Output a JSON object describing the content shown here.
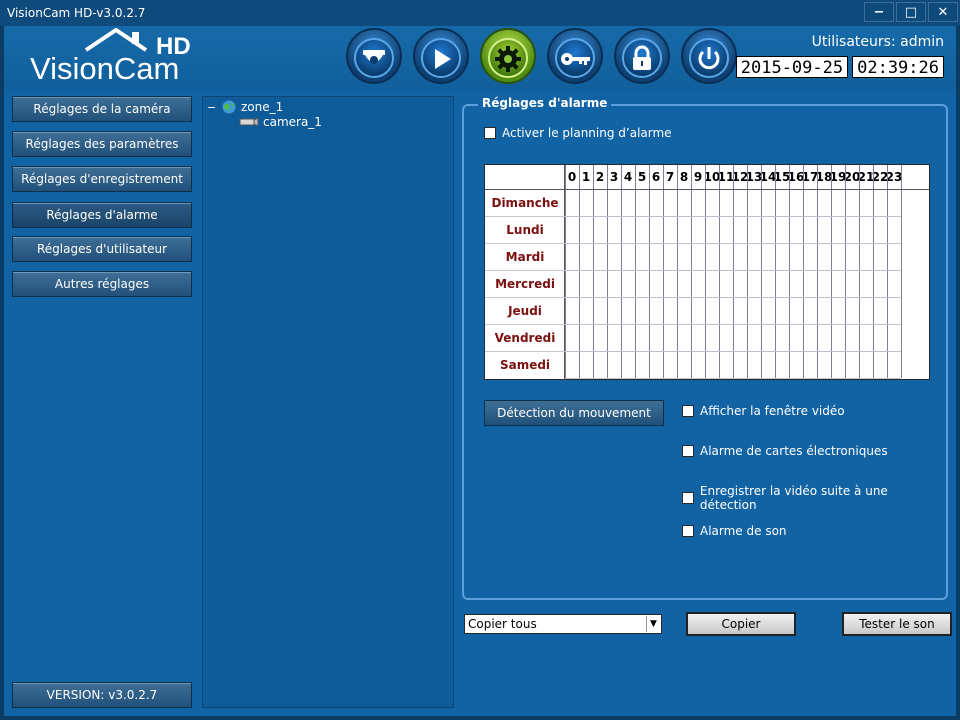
{
  "window": {
    "title": "VisionCam HD-v3.0.2.7",
    "minimize_label": "−",
    "maximize_label": "□",
    "close_label": "✕"
  },
  "header": {
    "logo_brand": "VisionCam",
    "logo_badge": "HD",
    "user_label": "Utilisateurs: admin",
    "date": "2015-09-25",
    "time": "02:39:26",
    "nav": [
      {
        "name": "camera-icon",
        "active": false
      },
      {
        "name": "play-icon",
        "active": false
      },
      {
        "name": "gear-icon",
        "active": true
      },
      {
        "name": "key-icon",
        "active": false
      },
      {
        "name": "lock-icon",
        "active": false
      },
      {
        "name": "power-icon",
        "active": false
      }
    ]
  },
  "sidebar": {
    "items": [
      {
        "label": "Réglages de la caméra"
      },
      {
        "label": "Réglages des paramètres"
      },
      {
        "label": "Réglages d'enregistrement"
      },
      {
        "label": "Réglages d'alarme",
        "active": true
      },
      {
        "label": "Réglages d'utilisateur"
      },
      {
        "label": "Autres réglages"
      }
    ],
    "version_label": "VERSION: v3.0.2.7"
  },
  "tree": {
    "zone": "zone_1",
    "camera": "camera_1",
    "collapse_glyph": "−"
  },
  "alarm": {
    "group_title": "Réglages d'alarme",
    "enable_schedule_label": "Activer le planning d’alarme",
    "enable_schedule_checked": false,
    "days": [
      "Dimanche",
      "Lundi",
      "Mardi",
      "Mercredi",
      "Jeudi",
      "Vendredi",
      "Samedi"
    ],
    "hours": [
      "0",
      "1",
      "2",
      "3",
      "4",
      "5",
      "6",
      "7",
      "8",
      "9",
      "10",
      "11",
      "12",
      "13",
      "14",
      "15",
      "16",
      "17",
      "18",
      "19",
      "20",
      "21",
      "22",
      "23"
    ],
    "motion_button": "Détection du mouvement",
    "options": [
      {
        "label": "Afficher la fenêtre vidéo",
        "checked": false
      },
      {
        "label": "Alarme de cartes électroniques",
        "checked": false
      },
      {
        "label": "Enregistrer la vidéo suite à une détection",
        "checked": false
      },
      {
        "label": "Alarme de son",
        "checked": false
      }
    ]
  },
  "footer": {
    "copy_select_value": "Copier tous",
    "copy_button": "Copier",
    "test_sound_button": "Tester le son"
  },
  "colors": {
    "panel_bg": "#1263a4",
    "titlebar": "#0e4a7c",
    "day_text": "#7a1010",
    "active_nav": "#7cb82a"
  }
}
